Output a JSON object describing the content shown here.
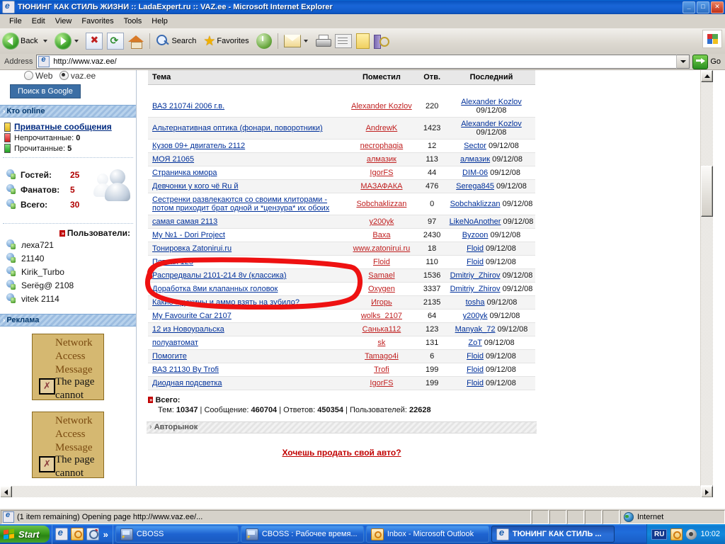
{
  "window": {
    "title": "ТЮНИНГ КАК СТИЛЬ ЖИЗНИ :: LadaExpert.ru :: VAZ.ee - Microsoft Internet Explorer",
    "minimize_label": "_",
    "maximize_label": "□",
    "close_label": "✕"
  },
  "menu": {
    "items": [
      {
        "label": "File"
      },
      {
        "label": "Edit"
      },
      {
        "label": "View"
      },
      {
        "label": "Favorites"
      },
      {
        "label": "Tools"
      },
      {
        "label": "Help"
      }
    ]
  },
  "toolbar": {
    "back_label": "Back",
    "search_label": "Search",
    "favorites_label": "Favorites",
    "icons": [
      "back-icon",
      "forward-icon",
      "stop-icon",
      "refresh-icon",
      "home-icon",
      "search-icon",
      "favorites-icon",
      "history-icon",
      "mail-icon",
      "print-icon",
      "edit-icon",
      "notes-icon",
      "discuss-icon"
    ]
  },
  "address": {
    "label": "Address",
    "value": "http://www.vaz.ee/",
    "placeholder": "",
    "go_label": "Go"
  },
  "sidebar": {
    "google": {
      "web_label": "Web",
      "site_label": "vaz.ee",
      "button_label": "Поиск в Google"
    },
    "online_header": "Кто online",
    "pm": {
      "link_label": "Приватные сообщения",
      "unread_label": "Непрочитанные:",
      "unread_value": "0",
      "read_label": "Прочитанные:",
      "read_value": "5"
    },
    "stats": [
      {
        "label": "Гостей:",
        "value": "25"
      },
      {
        "label": "Фанатов:",
        "value": "5"
      },
      {
        "label": "Всего:",
        "value": "30"
      }
    ],
    "users_header": "Пользователи:",
    "users": [
      {
        "name": "леха721"
      },
      {
        "name": "21140"
      },
      {
        "name": "Kirik_Turbo"
      },
      {
        "name": "Serёg@ 2108"
      },
      {
        "name": "vitek 2114"
      }
    ],
    "ads_header": "Реклама",
    "ads": [
      {
        "line1": "Network",
        "line2": "Access",
        "line3": "Message",
        "line4": "The page",
        "line5": "cannot"
      },
      {
        "line1": "Network",
        "line2": "Access",
        "line3": "Message",
        "line4": "The page",
        "line5": "cannot"
      }
    ]
  },
  "forum": {
    "columns": {
      "topic": "Тема",
      "author": "Поместил",
      "replies": "Отв.",
      "last": "Последний"
    },
    "rows": [
      {
        "topic": "ВАЗ 21074i 2006 г.в.",
        "author": "Alexander Kozlov",
        "replies": "220",
        "last_user": "Alexander Kozlov",
        "last_date": "09/12/08",
        "two_line_last": true
      },
      {
        "topic": "Альтернативная оптика (фонари, поворотники)",
        "author": "AndrewK",
        "replies": "1423",
        "last_user": "Alexander Kozlov",
        "last_date": "09/12/08",
        "two_line_last": true
      },
      {
        "topic": "Кузов 09+ двигатель 2112",
        "author": "necrophagia",
        "replies": "12",
        "last_user": "Sector",
        "last_date": "09/12/08",
        "two_line_last": false
      },
      {
        "topic": "МОЯ 21065",
        "author": "алмазик",
        "replies": "113",
        "last_user": "алмазик",
        "last_date": "09/12/08",
        "two_line_last": false
      },
      {
        "topic": "Страничка юмора",
        "author": "IgorFS",
        "replies": "44",
        "last_user": "DIM-06",
        "last_date": "09/12/08",
        "two_line_last": false
      },
      {
        "topic": "Девчонки у кого чё Ru й",
        "author": "МАЗАФАКА",
        "replies": "476",
        "last_user": "Serega845",
        "last_date": "09/12/08",
        "two_line_last": false
      },
      {
        "topic": "Сестренки развлекаются со своими клиторами - потом приходит брат одной и *цензура* их обоих",
        "author": "Sobchaklizzan",
        "replies": "0",
        "last_user": "Sobchaklizzan",
        "last_date": "09/12/08",
        "two_line_last": false
      },
      {
        "topic": "самая самая 2113",
        "author": "y200yk",
        "replies": "97",
        "last_user": "LikeNoAnother",
        "last_date": "09/12/08",
        "two_line_last": false
      },
      {
        "topic": "My №1 - Dori Project",
        "author": "Baxa",
        "replies": "2430",
        "last_user": "Byzoon",
        "last_date": "09/12/08",
        "two_line_last": false
      },
      {
        "topic": "Тонировка Zatonirui.ru",
        "author": "www.zatonirui.ru",
        "replies": "18",
        "last_user": "Floid",
        "last_date": "09/12/08",
        "two_line_last": false
      },
      {
        "topic": "Пятнах 125",
        "author": "Floid",
        "replies": "110",
        "last_user": "Floid",
        "last_date": "09/12/08",
        "two_line_last": false
      },
      {
        "topic": "Распредвалы 2101-214 8v (классика)",
        "author": "Samael",
        "replies": "1536",
        "last_user": "Dmitriy_Zhirov",
        "last_date": "09/12/08",
        "two_line_last": false
      },
      {
        "topic": "Доработка 8ми клапанных головок",
        "author": "Oxygen",
        "replies": "3337",
        "last_user": "Dmitriy_Zhirov",
        "last_date": "09/12/08",
        "two_line_last": false
      },
      {
        "topic": "Какие пружины и аммо взять на зубило?",
        "author": "Игорь",
        "replies": "2135",
        "last_user": "tosha",
        "last_date": "09/12/08",
        "two_line_last": false
      },
      {
        "topic": "My Favourite Car 2107",
        "author": "wolks_2107",
        "replies": "64",
        "last_user": "y200yk",
        "last_date": "09/12/08",
        "two_line_last": false
      },
      {
        "topic": "12 из Новоуральска",
        "author": "Санька112",
        "replies": "123",
        "last_user": "Manyak_72",
        "last_date": "09/12/08",
        "two_line_last": false
      },
      {
        "topic": "полуавтомат",
        "author": "sk",
        "replies": "131",
        "last_user": "ZoT",
        "last_date": "09/12/08",
        "two_line_last": false
      },
      {
        "topic": "Помогите",
        "author": "Tamago4i",
        "replies": "6",
        "last_user": "Floid",
        "last_date": "09/12/08",
        "two_line_last": false
      },
      {
        "topic": "ВАЗ 21130 By Trofi",
        "author": "Trofi",
        "replies": "199",
        "last_user": "Floid",
        "last_date": "09/12/08",
        "two_line_last": false
      },
      {
        "topic": "Диодная подсветка",
        "author": "IgorFS",
        "replies": "199",
        "last_user": "Floid",
        "last_date": "09/12/08",
        "two_line_last": false
      }
    ],
    "totals": {
      "header": "Всего:",
      "topics_label": "Тем:",
      "topics_value": "10347",
      "messages_label": "Сообщение:",
      "messages_value": "460704",
      "answers_label": "Ответов:",
      "answers_value": "450354",
      "users_label": "Пользователей:",
      "users_value": "22628"
    },
    "market_header": "Авторынок",
    "sell_link": "Хочешь продать свой авто?"
  },
  "annotation": {
    "shape": "red-ellipse-highlight",
    "color": "#ee1111"
  },
  "statusbar": {
    "text": "(1 item remaining) Opening page http://www.vaz.ee/...",
    "zone": "Internet"
  },
  "taskbar": {
    "start_label": "Start",
    "overflow_label": "»",
    "quick_launch": [
      "ie-icon",
      "outlook-icon",
      "contacts-icon"
    ],
    "tasks": [
      {
        "label": "CBOSS",
        "icon": "cboss-icon",
        "active": false
      },
      {
        "label": "CBOSS : Рабочее время...",
        "icon": "cboss-icon",
        "active": false
      },
      {
        "label": "Inbox - Microsoft Outlook",
        "icon": "outlook-icon",
        "active": false
      },
      {
        "label": "ТЮНИНГ КАК СТИЛЬ ...",
        "icon": "ie-icon",
        "active": true
      }
    ],
    "tray": {
      "language": "RU",
      "clock": "10:02"
    }
  }
}
